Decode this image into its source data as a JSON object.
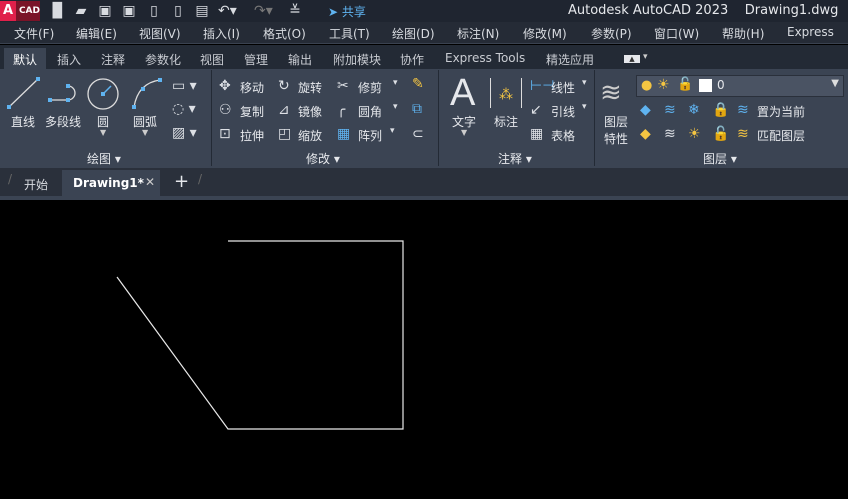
{
  "app": {
    "logo": "A",
    "logo_sub": "CAD",
    "title": "Autodesk AutoCAD 2023",
    "document": "Drawing1.dwg",
    "share": "共享"
  },
  "quick_access": [
    "new-icon",
    "open-icon",
    "save-icon",
    "save-as-icon",
    "open-from-web-icon",
    "save-to-web-icon",
    "plot-icon",
    "undo-icon",
    "redo-icon",
    "customize-icon"
  ],
  "menu": [
    "文件(F)",
    "编辑(E)",
    "视图(V)",
    "插入(I)",
    "格式(O)",
    "工具(T)",
    "绘图(D)",
    "标注(N)",
    "修改(M)",
    "参数(P)",
    "窗口(W)",
    "帮助(H)",
    "Express"
  ],
  "ribbon_tabs": [
    "默认",
    "插入",
    "注释",
    "参数化",
    "视图",
    "管理",
    "输出",
    "附加模块",
    "协作",
    "Express Tools",
    "精选应用"
  ],
  "draw": {
    "label": "绘图",
    "line": "直线",
    "polyline": "多段线",
    "circle": "圆",
    "arc": "圆弧"
  },
  "modify": {
    "label": "修改",
    "move": "移动",
    "rotate": "旋转",
    "trim": "修剪",
    "copy": "复制",
    "mirror": "镜像",
    "fillet": "圆角",
    "stretch": "拉伸",
    "scale": "缩放",
    "array": "阵列"
  },
  "annotation": {
    "label": "注释",
    "text": "文字",
    "dimension": "标注",
    "linear": "线性",
    "leader": "引线",
    "table": "表格"
  },
  "layers": {
    "label": "图层",
    "properties_1": "图层",
    "properties_2": "特性",
    "current_layer": "0",
    "set_current": "置为当前",
    "match": "匹配图层"
  },
  "file_tabs": {
    "start": "开始",
    "drawing": "Drawing1*"
  }
}
